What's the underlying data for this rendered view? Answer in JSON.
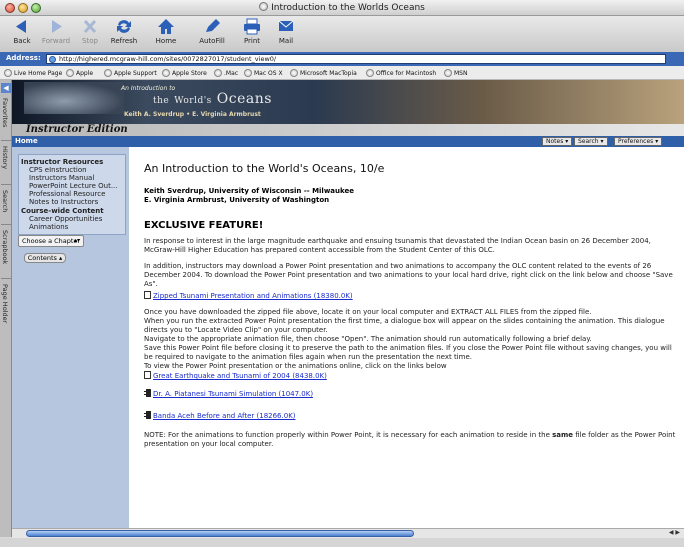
{
  "window": {
    "title": "Introduction to the Worlds Oceans"
  },
  "toolbar": {
    "back": "Back",
    "forward": "Forward",
    "stop": "Stop",
    "refresh": "Refresh",
    "home": "Home",
    "autofill": "AutoFill",
    "print": "Print",
    "mail": "Mail"
  },
  "address": {
    "label": "Address:",
    "url": "http://highered.mcgraw-hill.com/sites/0072827017/student_view0/"
  },
  "favorites": [
    "Live Home Page",
    "Apple",
    "Apple Support",
    "Apple Store",
    ".Mac",
    "Mac OS X",
    "Microsoft MacTopia",
    "Office for Macintosh",
    "MSN"
  ],
  "sidetabs": [
    "Favorites",
    "History",
    "Search",
    "Scrapbook",
    "Page Holder"
  ],
  "banner": {
    "intro": "An Introduction to",
    "the": "the",
    "worlds": "World's",
    "oceans": "Oceans",
    "authors": "Keith A. Sverdrup • E. Virginia Armbrust"
  },
  "edition": "Instructor Edition",
  "nav": {
    "home": "Home",
    "notes": "Notes ▾",
    "search": "Search ▾",
    "preferences": "Preferences ▾"
  },
  "leftnav": {
    "section1": "Instructor Resources",
    "items1": [
      "CPS eInstruction",
      "Instructors Manual",
      "PowerPoint Lecture Out...",
      "Professional Resource",
      "Notes to Instructors"
    ],
    "section2": "Course-wide Content",
    "items2": [
      "Career Opportunities",
      "Animations"
    ],
    "chapter_select": "Choose a Chapter",
    "contents": "Contents ▴"
  },
  "main": {
    "title": "An Introduction to the World's Oceans, 10/e",
    "author1": "Keith Sverdrup, University of Wisconsin -- Milwaukee",
    "author2": "E. Virginia Armbrust, University of Washington",
    "feature": "EXCLUSIVE FEATURE!",
    "p1": "In response to interest in the large magnitude earthquake and ensuing tsunamis that devastated the Indian Ocean basin on 26 December 2004, McGraw-Hill Higher Education has prepared content accessible from the Student Center of this OLC.",
    "p2": "In addition, instructors may download a Power Point presentation and two animations to accompany the OLC content related to the events of 26 December 2004. To download the Power Point presentation and two animations to your local hard drive, right click on the link below and choose \"Save As\".",
    "link_zip": "Zipped Tsunami Presentation and Animations (18380.0K)",
    "p3_1": "Once you have downloaded the zipped file above, locate it on your local computer and EXTRACT ALL FILES from the zipped file.",
    "p3_2": "When you run the extracted Power Point presentation the first time, a dialogue box will appear on the slides containing the animation. This dialogue directs you to \"Locate Video Clip\" on your computer.",
    "p3_3": "Navigate to the appropriate animation file, then choose \"Open\". The animation should run automatically following a brief delay.",
    "p3_4": "Save this Power Point file before closing it to preserve the path to the animation files. If you close the Power Point file without saving changes, you will be required to navigate to the animation files again when run the presentation the next time.",
    "p3_5": "To view the Power Point presentation or the animations online, click on the links below",
    "link_ppt": "Great Earthquake and Tsunami of 2004 (8438.0K)",
    "link_sim": "Dr. A. Piatanesi Tsunami Simulation (1047.0K)",
    "link_aceh": "Banda Aceh Before and After (18266.0K)",
    "note_a": "NOTE: For the animations to function properly within Power Point, it is necessary for each animation to reside in the ",
    "note_b": "same",
    "note_c": " file folder as the Power Point presentation on your local computer."
  }
}
